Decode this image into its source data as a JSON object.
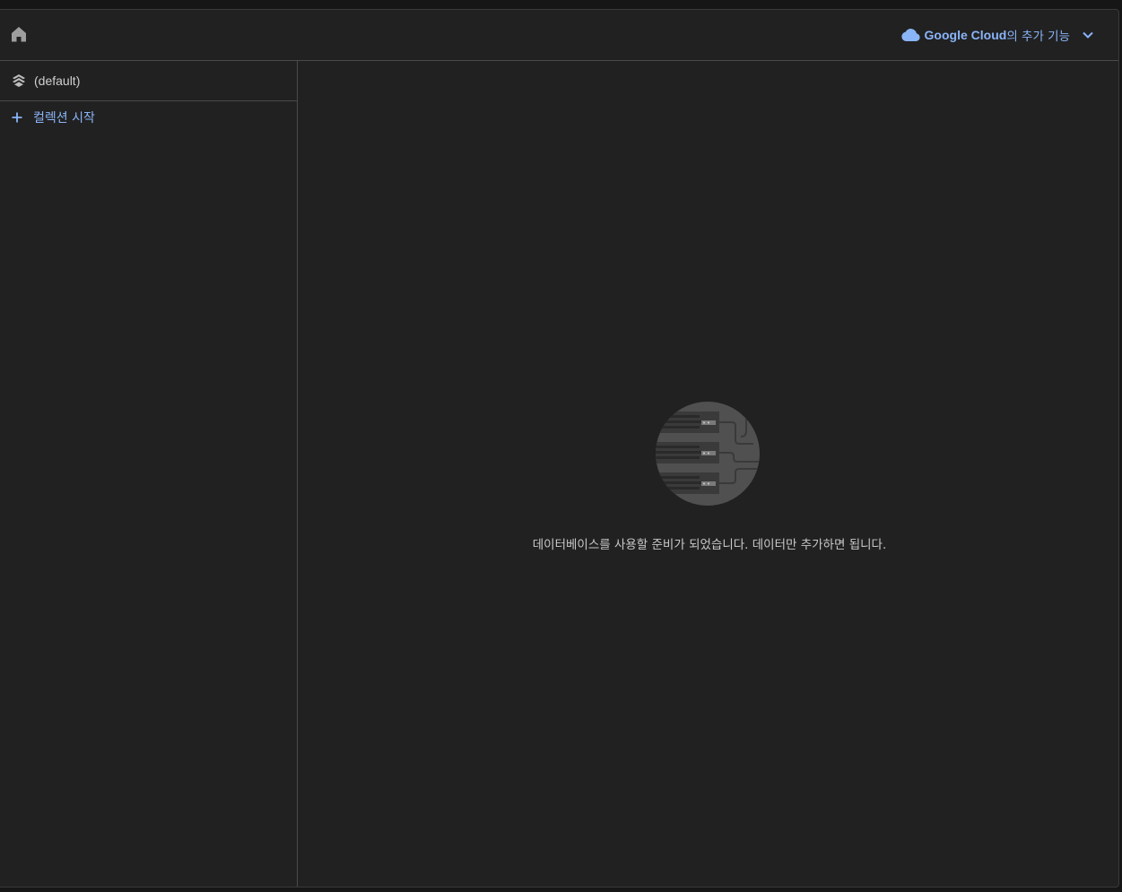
{
  "header": {
    "home_icon": "home-icon",
    "google_cloud": {
      "icon": "cloud-icon",
      "brand": "Google Cloud",
      "suffix": "의 추가 기능",
      "dropdown_icon": "chevron-down-icon"
    }
  },
  "sidebar": {
    "database": {
      "icon": "layers-icon",
      "label": "(default)"
    },
    "start_collection": {
      "icon": "plus-icon",
      "label": "컬렉션 시작"
    }
  },
  "main": {
    "illustration": "database-servers-illustration",
    "empty_message": "데이터베이스를 사용할 준비가 되었습니다. 데이터만 추가하면 됩니다."
  },
  "colors": {
    "background": "#212121",
    "border": "#4a4a4a",
    "accent": "#8ab4f8",
    "text": "#c8c8c8"
  }
}
